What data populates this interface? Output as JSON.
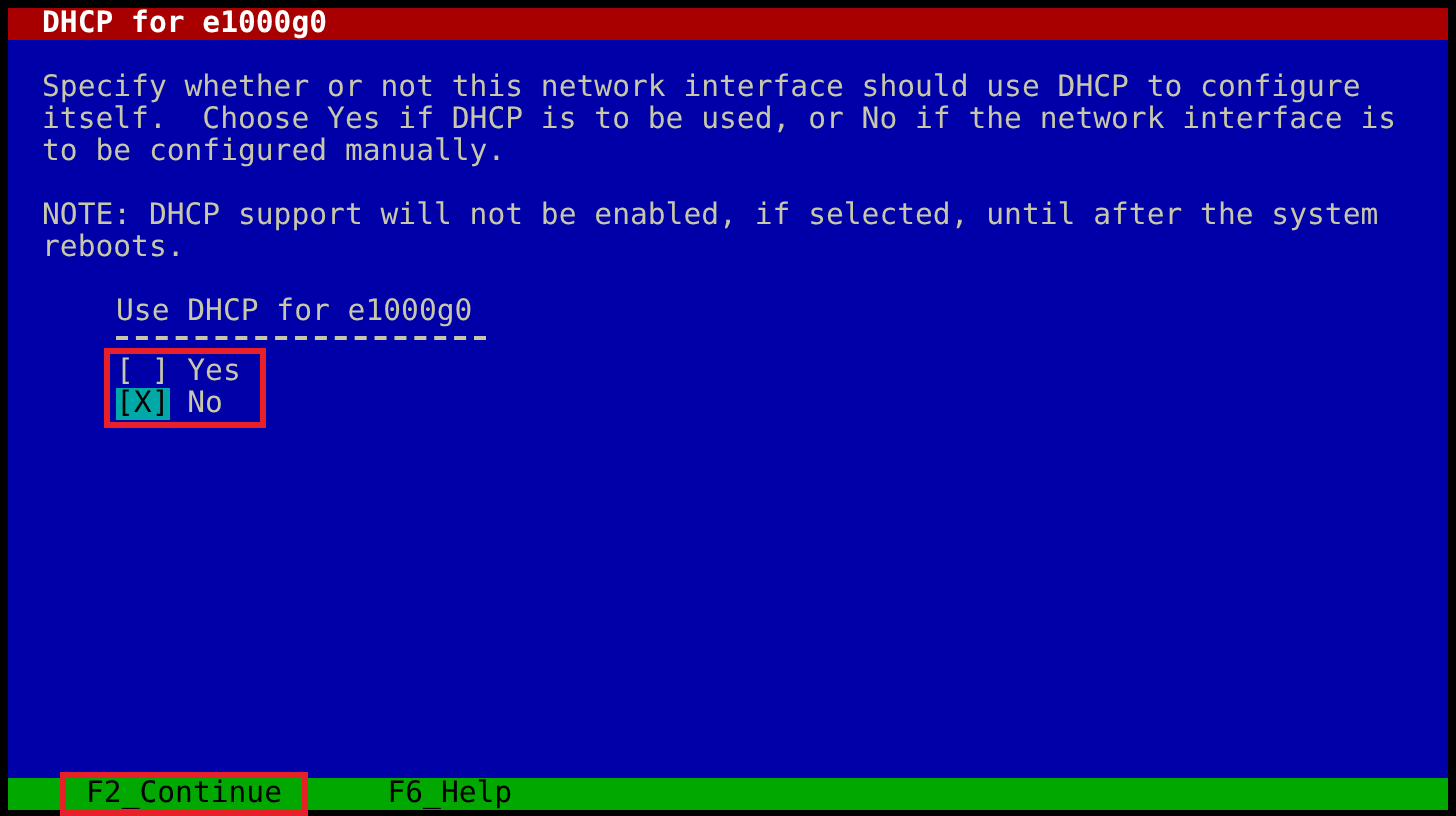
{
  "window": {
    "title": "DHCP for e1000g0"
  },
  "description": "Specify whether or not this network interface should use DHCP to configure itself.  Choose Yes if DHCP is to be used, or No if the network interface is to be configured manually.",
  "note": "NOTE: DHCP support will not be enabled, if selected, until after the system reboots.",
  "question": "Use DHCP for e1000g0",
  "options": [
    {
      "box": "[ ]",
      "label": "Yes",
      "selected": false
    },
    {
      "box": "[X]",
      "label": "No",
      "selected": true
    }
  ],
  "function_keys": [
    {
      "label": "F2_Continue",
      "highlighted": true
    },
    {
      "label": "F6_Help",
      "highlighted": false
    }
  ]
}
